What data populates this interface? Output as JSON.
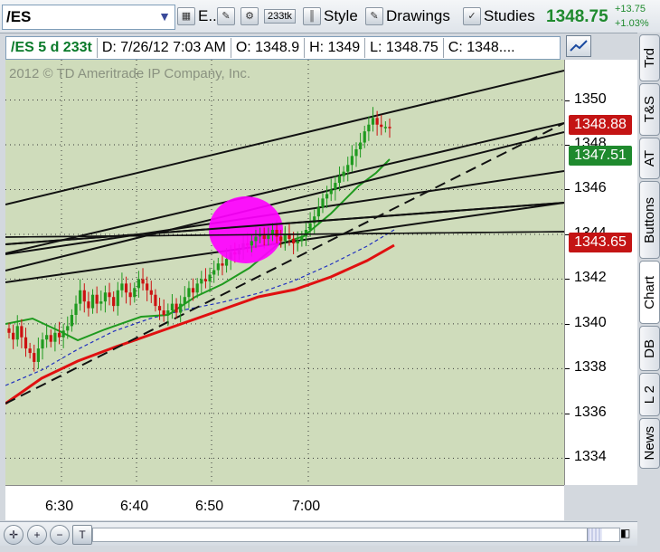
{
  "toolbar": {
    "symbol": "/ES",
    "exchange_label": "E...",
    "tick_label": "233tk",
    "style_label": "Style",
    "drawings_label": "Drawings",
    "studies_label": "Studies",
    "last_price": "1348.75",
    "change_abs": "+13.75",
    "change_pct": "+1.03%"
  },
  "info_bar": {
    "symbol_period": "/ES 5 d 233t",
    "date": "D: 7/26/12 7:03 AM",
    "open": "O: 1348.9",
    "high": "H: 1349",
    "low": "L: 1348.75",
    "close": "C: 1348...."
  },
  "watermark": "2012 © TD Ameritrade IP Company, Inc.",
  "price_axis": {
    "ticks": [
      "1350",
      "1348",
      "1346",
      "1344",
      "1342",
      "1340",
      "1338",
      "1336",
      "1334"
    ],
    "flags": [
      {
        "label": "1348.88",
        "value": 1348.88,
        "color": "#c41414"
      },
      {
        "label": "1347.51",
        "value": 1347.51,
        "color": "#1f8a2e"
      },
      {
        "label": "1343.65",
        "value": 1343.65,
        "color": "#c41414"
      }
    ]
  },
  "time_axis": {
    "ticks": [
      "6:30",
      "6:40",
      "6:50",
      "7:00"
    ]
  },
  "side_tabs": [
    "Trd",
    "T&S",
    "AT",
    "Buttons",
    "Chart",
    "DB",
    "L 2",
    "News"
  ],
  "colors": {
    "chart_bg": "#cfdcbb",
    "up_candle": "#1f9a1f",
    "down_candle": "#cc1111",
    "ma_green": "#1f9a1f",
    "ma_red": "#e01010",
    "ma_blue": "#2030c0",
    "highlight": "#ff00ff"
  },
  "chart_data": {
    "type": "candlestick",
    "y_range": [
      1332.8,
      1351.8
    ],
    "closes": [
      1339.6,
      1339.3,
      1339.9,
      1339.4,
      1338.9,
      1338.7,
      1338.3,
      1338.9,
      1339.3,
      1339.5,
      1339.2,
      1339.6,
      1339.4,
      1339.7,
      1339.9,
      1340.4,
      1340.9,
      1341.5,
      1341.0,
      1340.7,
      1341.3,
      1340.9,
      1341.0,
      1341.4,
      1341.2,
      1340.8,
      1341.5,
      1341.8,
      1341.4,
      1341.2,
      1341.6,
      1342.0,
      1341.8,
      1341.5,
      1341.3,
      1340.8,
      1340.6,
      1340.4,
      1340.6,
      1340.9,
      1340.5,
      1340.9,
      1341.2,
      1341.6,
      1341.4,
      1341.8,
      1342.0,
      1341.9,
      1342.2,
      1342.4,
      1342.7,
      1342.6,
      1342.9,
      1343.2,
      1343.1,
      1343.3,
      1343.6,
      1343.5,
      1343.7,
      1343.9,
      1344.0,
      1343.8,
      1344.0,
      1344.2,
      1343.9,
      1343.7,
      1344.0,
      1343.8,
      1343.6,
      1343.7,
      1343.9,
      1344.2,
      1344.5,
      1344.8,
      1345.2,
      1345.6,
      1345.8,
      1346.0,
      1346.3,
      1346.6,
      1346.8,
      1347.1,
      1347.5,
      1347.8,
      1348.1,
      1348.6,
      1348.9,
      1349.2,
      1348.9,
      1348.8,
      1348.8,
      1348.75
    ]
  }
}
